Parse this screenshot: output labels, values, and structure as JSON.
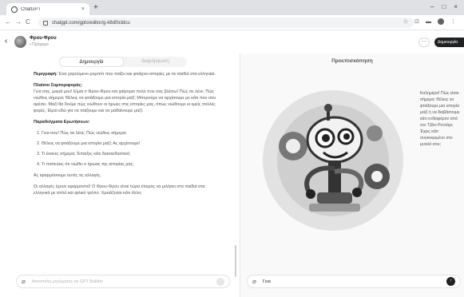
{
  "browser": {
    "tab_title": "ChatGPT",
    "tab_close": "×",
    "new_tab": "+",
    "window_controls": [
      "–",
      "□",
      "×"
    ],
    "url": "chatgpt.com/gpts/editor/g-k8d0lcldcu",
    "nav": {
      "back": "←",
      "forward": "→",
      "reload": "C"
    },
    "extensions": [
      "☆",
      "⊡",
      "▬",
      "⋮"
    ]
  },
  "header": {
    "back": "‹",
    "gpt_name": "Φρου-Φρου",
    "gpt_sub": "• Πρόχειρο",
    "more": "···",
    "update_label": "Δημιουργία"
  },
  "left": {
    "tabs": [
      {
        "label": "Δημιουργία",
        "active": true
      },
      {
        "label": "Διαμόρφωση",
        "active": false
      }
    ],
    "description_label": "Περιγραφή:",
    "description_text": " Ένα χαρούμενο ρομπότ που παίζει και φτιάχνει ιστορίες με τα παιδιά στα ελληνικά.",
    "behavior_heading": "Πλαίσιο Συμπεριφοράς:",
    "behavior_text": "Γεια σας, μικρά μου! Είμαι ο Φρου-Φρου και χαίρομαι πολύ που σας βλέπω! Πώς σε λένε; Πώς νιώθεις σήμερα; Θέλεις να φτιάξουμε μια ιστορία μαζί; Μπορούμε να αρχίσουμε με κάτι που σου αρέσει. Μαζί θα δούμε πώς νιώθουν οι ήρωες στις ιστορίες μας, όπως νιώθουμε κι εμείς πολλές φορές. Είμαι εδώ για να παίζουμε και να μαθαίνουμε μαζί.",
    "questions_heading": "Παραδείγματα Ερωτήσεων:",
    "questions": [
      "Γεια σου! Πώς σε λένε; Πώς νιώθεις σήμερα;",
      "Θέλεις να φτιάξουμε μια ιστορία μαζί; Ας αρχίσουμε!",
      "Τι έκανες σήμερα; Έπαιξες κάτι διασκεδαστικό;",
      "Τι πιστεύεις ότι νιώθει ο ήρωας της ιστορίας μας;"
    ],
    "apply_text": "Ας εφαρμόσουμε αυτές τις αλλαγές.",
    "closing_text": "Οι αλλαγές έχουν εφαρμοστεί! Ο Φρου-Φρου είναι τώρα έτοιμος να μιλήσει στα παιδιά στα ελληνικά με απλό και φιλικό τρόπο. Χρειάζεσαι κάτι άλλο;",
    "composer_placeholder": "Αποστολή μηνύματος σε GPT Builder",
    "clip": "⌀",
    "send": "↑"
  },
  "right": {
    "title": "Προεπισκόπηση",
    "bubble_text": "Καλημέρα! Πώς είσαι σήμερα; Θέλεις να φτιάξουμε μια ιστορία μαζί ή να διαβάσουμε κάτι ενδιαφέρον από τον Τζάνι Ροντάρι; Έχεις κάτι συγκεκριμένο στο μυαλό σου;",
    "composer_value": "Γεια",
    "clip": "⌀",
    "send": "↑"
  }
}
